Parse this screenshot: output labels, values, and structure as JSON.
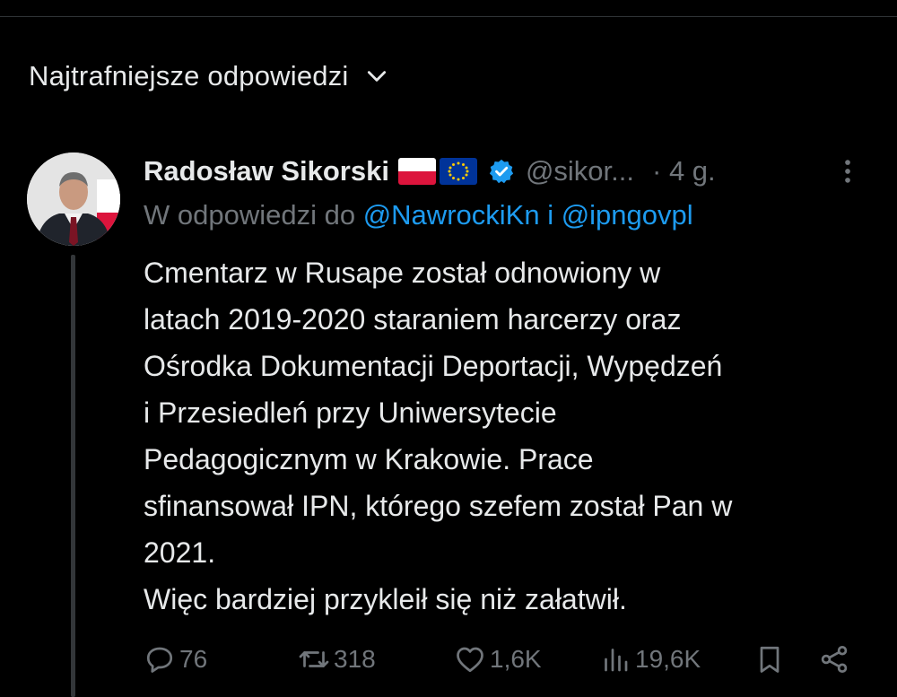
{
  "sort": {
    "label": "Najtrafniejsze odpowiedzi",
    "icon": "chevron-down-icon"
  },
  "tweet": {
    "author": {
      "name": "Radosław Sikorski",
      "flags": [
        "flag-poland",
        "flag-eu"
      ],
      "verified": true,
      "handle": "@sikor...",
      "time": "· 4 g."
    },
    "reply_to": {
      "prefix": "W odpowiedzi do",
      "mention_1": "@NawrockiKn",
      "conjunction": "i",
      "mention_2": "@ipngovpl"
    },
    "text_lines": [
      "Cmentarz w Rusape został odnowiony w",
      "latach 2019-2020 staraniem harcerzy oraz",
      "Ośrodka Dokumentacji Deportacji, Wypędzeń",
      "i Przesiedleń przy Uniwersytecie",
      "Pedagogicznym w Krakowie. Prace",
      "sfinansował IPN, którego szefem został Pan w",
      "2021.",
      "Więc bardziej przykleił się niż załatwił."
    ],
    "stats": {
      "replies": "76",
      "reposts": "318",
      "likes": "1,6K",
      "views": "19,6K"
    }
  },
  "colors": {
    "background": "#000000",
    "text": "#e7e9ea",
    "muted": "#71767b",
    "accent": "#1d9bf0"
  }
}
